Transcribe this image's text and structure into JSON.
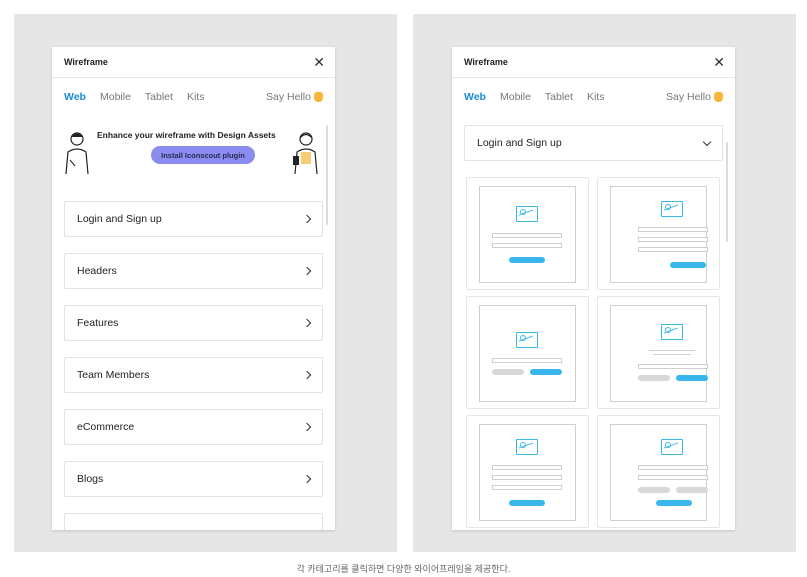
{
  "left_panel": {
    "title": "Wireframe",
    "tabs": [
      "Web",
      "Mobile",
      "Tablet",
      "Kits"
    ],
    "active_tab": "Web",
    "say_hello": "Say Hello",
    "banner": {
      "text": "Enhance your wireframe with Design Assets",
      "button": "Install Iconscout plugin"
    },
    "categories": [
      "Login and Sign up",
      "Headers",
      "Features",
      "Team Members",
      "eCommerce",
      "Blogs"
    ]
  },
  "right_panel": {
    "title": "Wireframe",
    "tabs": [
      "Web",
      "Mobile",
      "Tablet",
      "Kits"
    ],
    "active_tab": "Web",
    "say_hello": "Say Hello",
    "selected_category": "Login and Sign up"
  },
  "caption": "각 카테고리를 클릭하면 다양한 와이어프레임을 제공한다.",
  "colors": {
    "accent": "#1a8bd6",
    "wire_blue": "#39b7ec",
    "button_purple": "#8b8cf0",
    "hand": "#f5b73b"
  }
}
